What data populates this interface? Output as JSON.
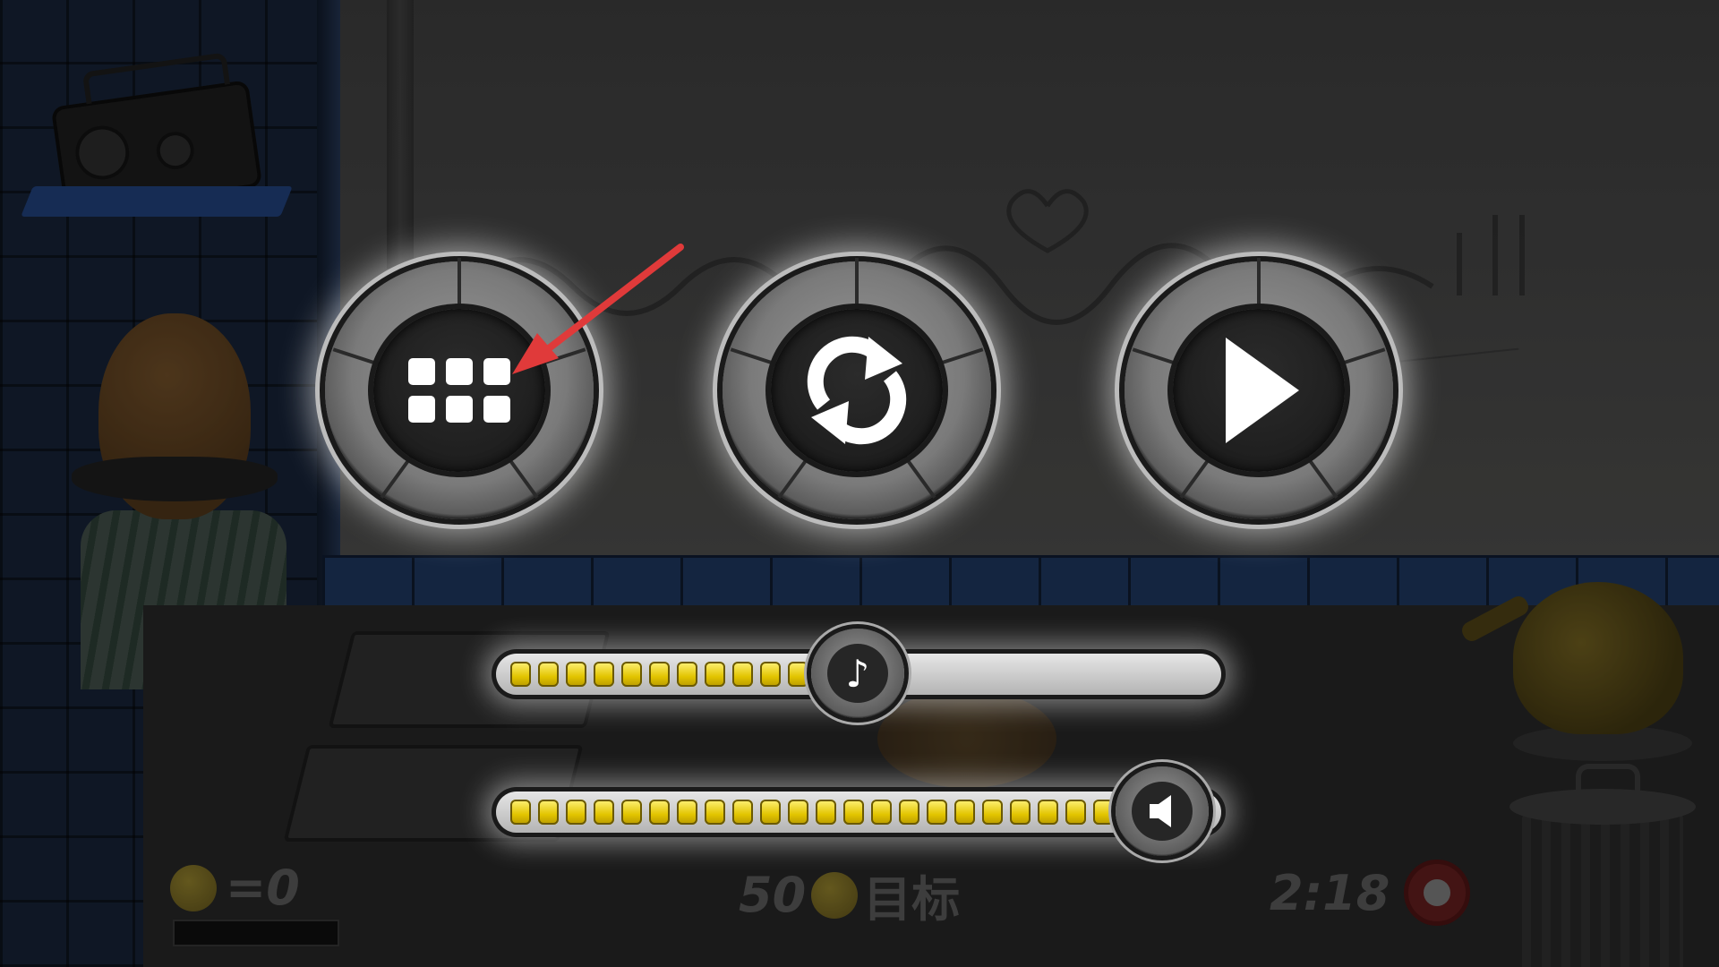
{
  "pause_menu": {
    "menu_button_icon": "grid-menu-icon",
    "restart_button_icon": "restart-icon",
    "resume_button_icon": "play-icon"
  },
  "music_slider": {
    "icon": "music-note-icon",
    "level": 0.39,
    "filled_pips": 11
  },
  "sound_slider": {
    "icon": "speaker-icon",
    "level": 0.92,
    "filled_pips": 22
  },
  "hud": {
    "coins_text": "=0",
    "target_number": "50",
    "target_label": "目标",
    "timer": "2:18"
  },
  "annotation": {
    "color": "#e03a3a"
  }
}
